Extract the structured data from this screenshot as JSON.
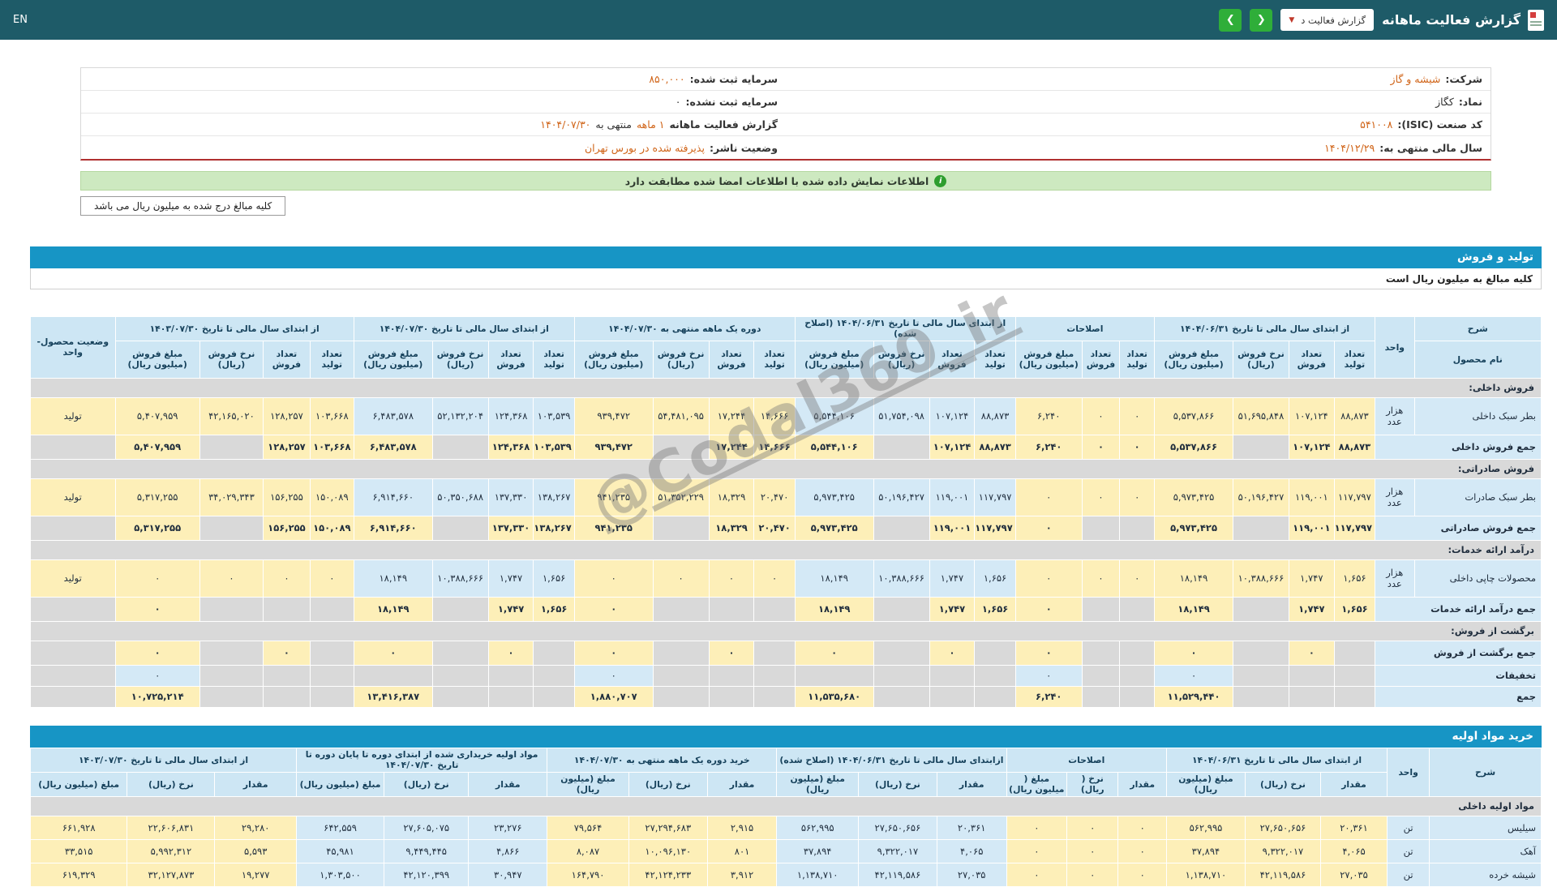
{
  "topbar": {
    "title": "گزارش فعالیت ماهانه",
    "dropdown_label": "گزارش فعالیت د",
    "nav_right": "❮",
    "nav_left": "❯",
    "lang": "EN"
  },
  "company": {
    "rows": [
      {
        "right": {
          "label": "شرکت:",
          "value": "شیشه و گاز"
        },
        "left": {
          "label": "سرمایه ثبت شده:",
          "value": "۸۵۰,۰۰۰"
        }
      },
      {
        "right": {
          "label": "نماد:",
          "value": "کگاز",
          "plain": true
        },
        "left": {
          "label": "سرمایه ثبت نشده:",
          "value": "۰",
          "plain": true
        }
      },
      {
        "right": {
          "label": "کد صنعت (ISIC):",
          "value": "۵۴۱۰۰۸"
        },
        "left": {
          "label": "گزارش فعالیت ماهانه",
          "value": "۱ ماهه",
          "mid": "منتهی به",
          "value2": "۱۴۰۴/۰۷/۳۰"
        }
      },
      {
        "right": {
          "label": "سال مالی منتهی به:",
          "value": "۱۴۰۴/۱۲/۲۹"
        },
        "left": {
          "label": "وضعیت ناشر:",
          "value": "پذیرفته شده در بورس تهران"
        }
      }
    ]
  },
  "banner": {
    "text": "اطلاعات نمایش داده شده با اطلاعات امضا شده مطابقت دارد"
  },
  "note_button": {
    "label": "کلیه مبالغ درج شده به میلیون ریال می باشد"
  },
  "watermark": {
    "text": "@Codal360_ir"
  },
  "colors": {
    "topbar_teal": "#1e5b68",
    "section_blue": "#1795c5",
    "green_button": "#2fae39",
    "value_orange": "#d06418",
    "cell_yellow": "#fdefb8",
    "cell_blue": "#d4e9f6",
    "cell_gray": "#d9d9d9"
  },
  "production": {
    "title": "تولید و فروش",
    "subtitle": "کلیه مبالغ به میلیون ریال است",
    "table": {
      "col_widths": [
        8.4,
        2.6,
        2.7,
        3.0,
        3.7,
        5.2,
        2.3,
        2.5,
        4.4,
        2.7,
        3.0,
        3.7,
        5.2,
        2.7,
        3.0,
        3.7,
        5.2,
        2.7,
        3.0,
        3.7,
        5.2,
        2.9,
        3.1,
        4.2,
        5.6,
        5.6
      ],
      "group_colors": [
        "y",
        "y",
        "b",
        "y",
        "b",
        "y"
      ],
      "head": {
        "desc": "شرح",
        "desc_sub": "نام محصول",
        "unit": "واحد",
        "status": "وضعیت محصول-واحد",
        "groups": [
          {
            "label": "از ابتدای سال مالی تا تاریخ ۱۴۰۴/۰۶/۳۱",
            "cols": [
              "تعداد تولید",
              "تعداد فروش",
              "نرخ فروش (ریال)",
              "مبلغ فروش (میلیون ریال)"
            ]
          },
          {
            "label": "اصلاحات",
            "cols": [
              "تعداد تولید",
              "تعداد فروش",
              "مبلغ فروش (میلیون ریال)"
            ]
          },
          {
            "label": "از ابتدای سال مالی تا تاریخ ۱۴۰۴/۰۶/۳۱ (اصلاح شده)",
            "cols": [
              "تعداد تولید",
              "تعداد فروش",
              "نرخ فروش (ریال)",
              "مبلغ فروش (میلیون ریال)"
            ]
          },
          {
            "label": "دوره یک ماهه منتهی به ۱۴۰۴/۰۷/۳۰",
            "cols": [
              "تعداد تولید",
              "تعداد فروش",
              "نرخ فروش (ریال)",
              "مبلغ فروش (میلیون ریال)"
            ]
          },
          {
            "label": "از ابتدای سال مالی تا تاریخ ۱۴۰۴/۰۷/۳۰",
            "cols": [
              "تعداد تولید",
              "تعداد فروش",
              "نرخ فروش (ریال)",
              "مبلغ فروش (میلیون ریال)"
            ]
          },
          {
            "label": "از ابتدای سال مالی تا تاریخ ۱۴۰۳/۰۷/۳۰",
            "cols": [
              "تعداد تولید",
              "تعداد فروش",
              "نرخ فروش (ریال)",
              "مبلغ فروش (میلیون ریال)"
            ]
          }
        ]
      },
      "rows": [
        {
          "t": "section",
          "label": "فروش داخلی:"
        },
        {
          "t": "product",
          "name": "بطر سبک داخلی",
          "unit": "هزار عدد",
          "status": "تولید",
          "g": [
            [
              "۸۸,۸۷۳",
              "۱۰۷,۱۲۴",
              "۵۱,۶۹۵,۸۴۸",
              "۵,۵۳۷,۸۶۶"
            ],
            [
              "۰",
              "۰",
              "۶,۲۴۰"
            ],
            [
              "۸۸,۸۷۳",
              "۱۰۷,۱۲۴",
              "۵۱,۷۵۴,۰۹۸",
              "۵,۵۴۴,۱۰۶"
            ],
            [
              "۱۴,۶۶۶",
              "۱۷,۲۴۴",
              "۵۴,۴۸۱,۰۹۵",
              "۹۳۹,۴۷۲"
            ],
            [
              "۱۰۳,۵۳۹",
              "۱۲۴,۳۶۸",
              "۵۲,۱۳۲,۲۰۴",
              "۶,۴۸۳,۵۷۸"
            ],
            [
              "۱۰۳,۶۶۸",
              "۱۲۸,۲۵۷",
              "۴۲,۱۶۵,۰۲۰",
              "۵,۴۰۷,۹۵۹"
            ]
          ]
        },
        {
          "t": "sum",
          "name": "جمع فروش داخلی",
          "g": [
            [
              "۸۸,۸۷۳",
              "۱۰۷,۱۲۴",
              "",
              "۵,۵۳۷,۸۶۶"
            ],
            [
              "۰",
              "۰",
              "۶,۲۴۰"
            ],
            [
              "۸۸,۸۷۳",
              "۱۰۷,۱۲۴",
              "",
              "۵,۵۴۴,۱۰۶"
            ],
            [
              "۱۴,۶۶۶",
              "۱۷,۲۴۴",
              "",
              "۹۳۹,۴۷۲"
            ],
            [
              "۱۰۳,۵۳۹",
              "۱۲۴,۳۶۸",
              "",
              "۶,۴۸۳,۵۷۸"
            ],
            [
              "۱۰۳,۶۶۸",
              "۱۲۸,۲۵۷",
              "",
              "۵,۴۰۷,۹۵۹"
            ]
          ]
        },
        {
          "t": "section",
          "label": "فروش صادراتی:"
        },
        {
          "t": "product",
          "name": "بطر سبک صادرات",
          "unit": "هزار عدد",
          "status": "تولید",
          "g": [
            [
              "۱۱۷,۷۹۷",
              "۱۱۹,۰۰۱",
              "۵۰,۱۹۶,۴۲۷",
              "۵,۹۷۳,۴۲۵"
            ],
            [
              "۰",
              "۰",
              "۰"
            ],
            [
              "۱۱۷,۷۹۷",
              "۱۱۹,۰۰۱",
              "۵۰,۱۹۶,۴۲۷",
              "۵,۹۷۳,۴۲۵"
            ],
            [
              "۲۰,۴۷۰",
              "۱۸,۳۲۹",
              "۵۱,۳۵۲,۲۲۹",
              "۹۴۱,۲۳۵"
            ],
            [
              "۱۳۸,۲۶۷",
              "۱۳۷,۳۳۰",
              "۵۰,۳۵۰,۶۸۸",
              "۶,۹۱۴,۶۶۰"
            ],
            [
              "۱۵۰,۰۸۹",
              "۱۵۶,۲۵۵",
              "۳۴,۰۲۹,۳۴۳",
              "۵,۳۱۷,۲۵۵"
            ]
          ]
        },
        {
          "t": "sum",
          "name": "جمع فروش صادراتی",
          "g": [
            [
              "۱۱۷,۷۹۷",
              "۱۱۹,۰۰۱",
              "",
              "۵,۹۷۳,۴۲۵"
            ],
            [
              "",
              "",
              "۰"
            ],
            [
              "۱۱۷,۷۹۷",
              "۱۱۹,۰۰۱",
              "",
              "۵,۹۷۳,۴۲۵"
            ],
            [
              "۲۰,۴۷۰",
              "۱۸,۳۲۹",
              "",
              "۹۴۱,۲۳۵"
            ],
            [
              "۱۳۸,۲۶۷",
              "۱۳۷,۳۳۰",
              "",
              "۶,۹۱۴,۶۶۰"
            ],
            [
              "۱۵۰,۰۸۹",
              "۱۵۶,۲۵۵",
              "",
              "۵,۳۱۷,۲۵۵"
            ]
          ]
        },
        {
          "t": "section",
          "label": "درآمد ارائه خدمات:"
        },
        {
          "t": "product",
          "name": "محصولات چاپی داخلی",
          "unit": "هزار عدد",
          "status": "تولید",
          "g": [
            [
              "۱,۶۵۶",
              "۱,۷۴۷",
              "۱۰,۳۸۸,۶۶۶",
              "۱۸,۱۴۹"
            ],
            [
              "۰",
              "۰",
              "۰"
            ],
            [
              "۱,۶۵۶",
              "۱,۷۴۷",
              "۱۰,۳۸۸,۶۶۶",
              "۱۸,۱۴۹"
            ],
            [
              "۰",
              "۰",
              "۰",
              "۰"
            ],
            [
              "۱,۶۵۶",
              "۱,۷۴۷",
              "۱۰,۳۸۸,۶۶۶",
              "۱۸,۱۴۹"
            ],
            [
              "۰",
              "۰",
              "۰",
              "۰"
            ]
          ]
        },
        {
          "t": "sum",
          "name": "جمع درآمد ارائه خدمات",
          "g": [
            [
              "۱,۶۵۶",
              "۱,۷۴۷",
              "",
              "۱۸,۱۴۹"
            ],
            [
              "",
              "",
              "۰"
            ],
            [
              "۱,۶۵۶",
              "۱,۷۴۷",
              "",
              "۱۸,۱۴۹"
            ],
            [
              "",
              "",
              "",
              "۰"
            ],
            [
              "۱,۶۵۶",
              "۱,۷۴۷",
              "",
              "۱۸,۱۴۹"
            ],
            [
              "",
              "",
              "",
              "۰"
            ]
          ]
        },
        {
          "t": "section",
          "label": "برگشت از فروش:"
        },
        {
          "t": "sum",
          "name": "جمع برگشت از فروش",
          "g": [
            [
              "",
              "۰",
              "",
              "۰"
            ],
            [
              "",
              "",
              "۰"
            ],
            [
              "",
              "۰",
              "",
              "۰"
            ],
            [
              "",
              "۰",
              "",
              "۰"
            ],
            [
              "",
              "۰",
              "",
              "۰"
            ],
            [
              "",
              "۰",
              "",
              "۰"
            ]
          ]
        },
        {
          "t": "disc",
          "name": "تخفیفات",
          "g": [
            [
              "",
              "",
              "",
              "۰"
            ],
            [
              "",
              "",
              "۰"
            ],
            [
              "",
              "",
              "",
              ""
            ],
            [
              "",
              "",
              "",
              "۰"
            ],
            [
              "",
              "",
              "",
              ""
            ],
            [
              "",
              "",
              "",
              "۰"
            ]
          ]
        },
        {
          "t": "total",
          "name": "جمع",
          "g": [
            [
              "",
              "",
              "",
              "۱۱,۵۲۹,۴۴۰"
            ],
            [
              "",
              "",
              "۶,۲۴۰"
            ],
            [
              "",
              "",
              "",
              "۱۱,۵۳۵,۶۸۰"
            ],
            [
              "",
              "",
              "",
              "۱,۸۸۰,۷۰۷"
            ],
            [
              "",
              "",
              "",
              "۱۳,۴۱۶,۳۸۷"
            ],
            [
              "",
              "",
              "",
              "۱۰,۷۲۵,۲۱۴"
            ]
          ]
        }
      ]
    }
  },
  "materials": {
    "title": "خرید مواد اولیه",
    "table": {
      "col_widths": [
        7.4,
        2.8,
        4.4,
        5.0,
        5.2,
        3.2,
        3.4,
        4.0,
        4.6,
        5.2,
        5.4,
        4.6,
        5.2,
        5.4,
        5.2,
        5.6,
        5.8,
        5.4,
        5.8,
        6.4
      ],
      "group_colors": [
        "y",
        "y",
        "b",
        "y",
        "b",
        "y"
      ],
      "head": {
        "desc": "شرح",
        "unit": "واحد",
        "groups": [
          {
            "label": "از ابتدای سال مالی تا تاریخ ۱۴۰۴/۰۶/۳۱",
            "cols": [
              "مقدار",
              "نرخ (ریال)",
              "مبلغ (میلیون ریال)"
            ]
          },
          {
            "label": "اصلاحات",
            "cols": [
              "مقدار",
              "نرخ ( ریال)",
              "مبلغ ( میلیون ریال)"
            ]
          },
          {
            "label": "ازابتدای سال مالی تا تاریخ ۱۴۰۴/۰۶/۳۱ (اصلاح شده)",
            "cols": [
              "مقدار",
              "نرخ (ریال)",
              "مبلغ (میلیون ریال)"
            ]
          },
          {
            "label": "خرید دوره یک ماهه منتهی به ۱۴۰۴/۰۷/۳۰",
            "cols": [
              "مقدار",
              "نرخ (ریال)",
              "مبلغ (میلیون ریال)"
            ]
          },
          {
            "label": "مواد اولیه خریداری شده از ابتدای دوره تا پایان دوره تا تاریخ ۱۴۰۴/۰۷/۳۰",
            "cols": [
              "مقدار",
              "نرخ (ریال)",
              "مبلغ (میلیون ریال)"
            ]
          },
          {
            "label": "از ابتدای سال مالی تا تاریخ ۱۴۰۳/۰۷/۳۰",
            "cols": [
              "مقدار",
              "نرخ (ریال)",
              "مبلغ (میلیون ریال)"
            ]
          }
        ]
      },
      "rows": [
        {
          "t": "section",
          "label": "مواد اولیه داخلی"
        },
        {
          "t": "product",
          "name": "سیلیس",
          "unit": "تن",
          "g": [
            [
              "۲۰,۳۶۱",
              "۲۷,۶۵۰,۶۵۶",
              "۵۶۲,۹۹۵"
            ],
            [
              "۰",
              "۰",
              "۰"
            ],
            [
              "۲۰,۳۶۱",
              "۲۷,۶۵۰,۶۵۶",
              "۵۶۲,۹۹۵"
            ],
            [
              "۲,۹۱۵",
              "۲۷,۲۹۴,۶۸۳",
              "۷۹,۵۶۴"
            ],
            [
              "۲۳,۲۷۶",
              "۲۷,۶۰۵,۰۷۵",
              "۶۴۲,۵۵۹"
            ],
            [
              "۲۹,۲۸۰",
              "۲۲,۶۰۶,۸۳۱",
              "۶۶۱,۹۲۸"
            ]
          ]
        },
        {
          "t": "product",
          "name": "آهک",
          "unit": "تن",
          "g": [
            [
              "۴,۰۶۵",
              "۹,۳۲۲,۰۱۷",
              "۳۷,۸۹۴"
            ],
            [
              "۰",
              "۰",
              "۰"
            ],
            [
              "۴,۰۶۵",
              "۹,۳۲۲,۰۱۷",
              "۳۷,۸۹۴"
            ],
            [
              "۸۰۱",
              "۱۰,۰۹۶,۱۳۰",
              "۸,۰۸۷"
            ],
            [
              "۴,۸۶۶",
              "۹,۴۴۹,۴۴۵",
              "۴۵,۹۸۱"
            ],
            [
              "۵,۵۹۳",
              "۵,۹۹۲,۳۱۲",
              "۳۳,۵۱۵"
            ]
          ]
        },
        {
          "t": "product",
          "name": "شیشه خرده",
          "unit": "تن",
          "g": [
            [
              "۲۷,۰۳۵",
              "۴۲,۱۱۹,۵۸۶",
              "۱,۱۳۸,۷۱۰"
            ],
            [
              "۰",
              "۰",
              "۰"
            ],
            [
              "۲۷,۰۳۵",
              "۴۲,۱۱۹,۵۸۶",
              "۱,۱۳۸,۷۱۰"
            ],
            [
              "۳,۹۱۲",
              "۴۲,۱۲۴,۲۳۳",
              "۱۶۴,۷۹۰"
            ],
            [
              "۳۰,۹۴۷",
              "۴۲,۱۲۰,۳۹۹",
              "۱,۳۰۳,۵۰۰"
            ],
            [
              "۱۹,۲۷۷",
              "۳۲,۱۲۷,۸۷۳",
              "۶۱۹,۳۲۹"
            ]
          ]
        }
      ]
    }
  }
}
